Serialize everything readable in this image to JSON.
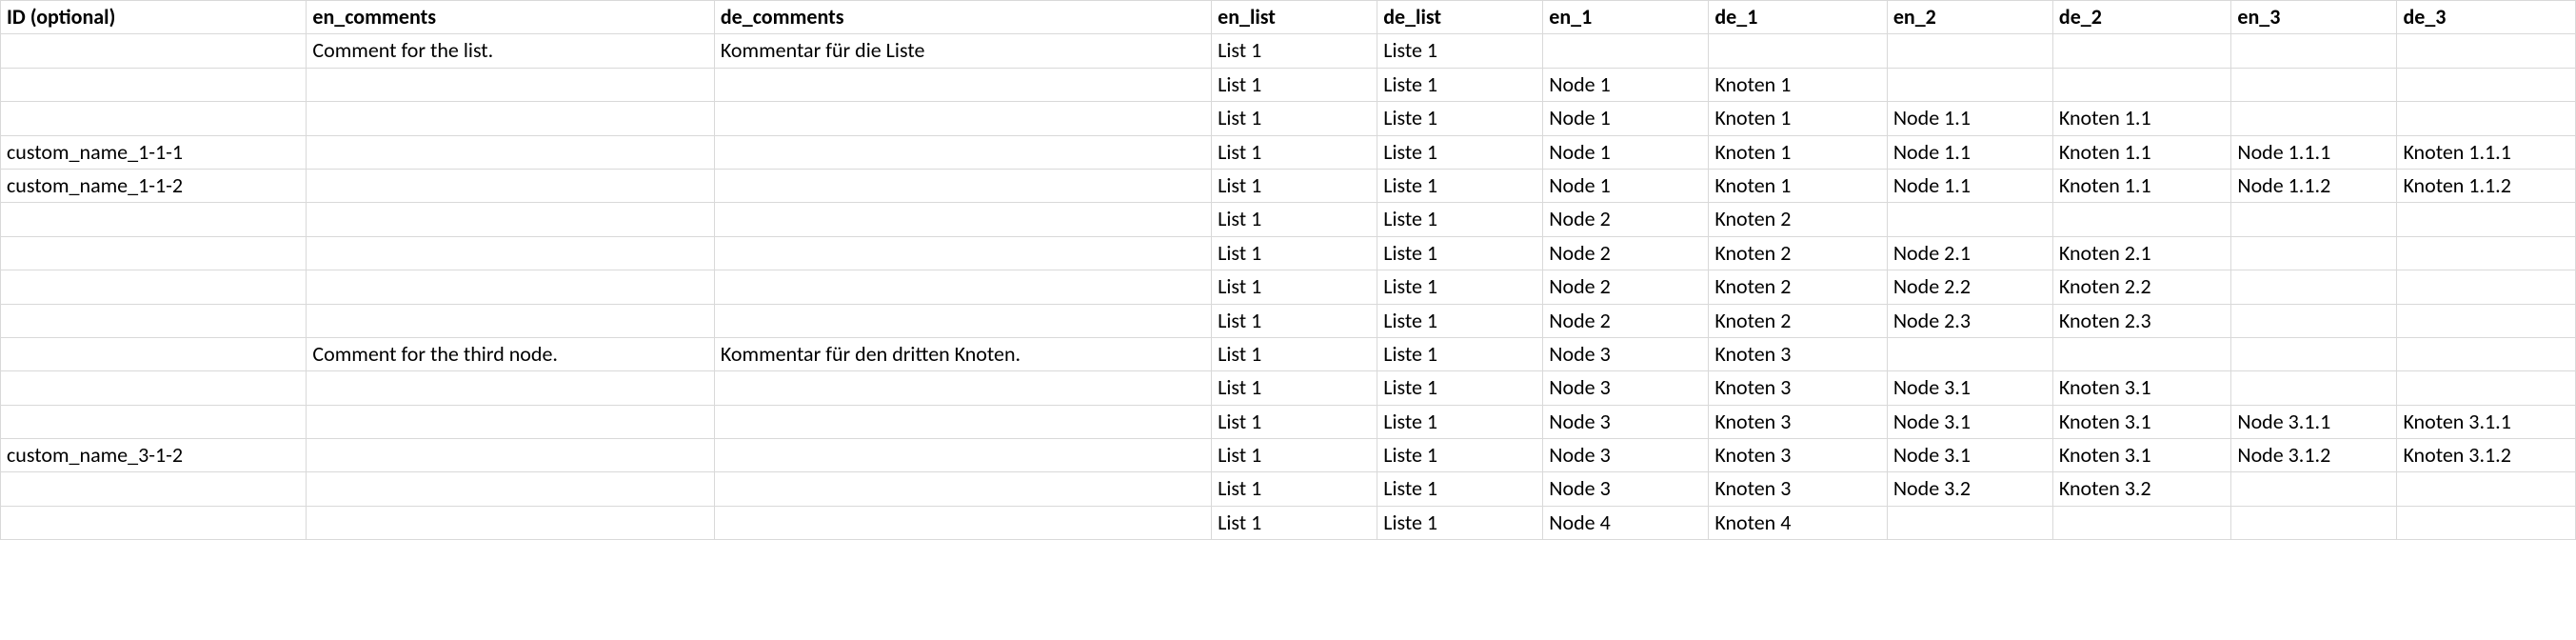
{
  "table": {
    "headers": [
      "ID (optional)",
      "en_comments",
      "de_comments",
      "en_list",
      "de_list",
      "en_1",
      "de_1",
      "en_2",
      "de_2",
      "en_3",
      "de_3"
    ],
    "rows": [
      [
        "",
        "Comment for the list.",
        "Kommentar für die Liste",
        "List 1",
        "Liste 1",
        "",
        "",
        "",
        "",
        "",
        ""
      ],
      [
        "",
        "",
        "",
        "List 1",
        "Liste 1",
        "Node 1",
        "Knoten 1",
        "",
        "",
        "",
        ""
      ],
      [
        "",
        "",
        "",
        "List 1",
        "Liste 1",
        "Node 1",
        "Knoten 1",
        "Node 1.1",
        "Knoten 1.1",
        "",
        ""
      ],
      [
        "custom_name_1-1-1",
        "",
        "",
        "List 1",
        "Liste 1",
        "Node 1",
        "Knoten 1",
        "Node 1.1",
        "Knoten 1.1",
        "Node 1.1.1",
        "Knoten 1.1.1"
      ],
      [
        "custom_name_1-1-2",
        "",
        "",
        "List 1",
        "Liste 1",
        "Node 1",
        "Knoten 1",
        "Node 1.1",
        "Knoten 1.1",
        "Node 1.1.2",
        "Knoten 1.1.2"
      ],
      [
        "",
        "",
        "",
        "List 1",
        "Liste 1",
        "Node 2",
        "Knoten 2",
        "",
        "",
        "",
        ""
      ],
      [
        "",
        "",
        "",
        "List 1",
        "Liste 1",
        "Node 2",
        "Knoten 2",
        "Node 2.1",
        "Knoten 2.1",
        "",
        ""
      ],
      [
        "",
        "",
        "",
        "List 1",
        "Liste 1",
        "Node 2",
        "Knoten 2",
        "Node 2.2",
        "Knoten 2.2",
        "",
        ""
      ],
      [
        "",
        "",
        "",
        "List 1",
        "Liste 1",
        "Node 2",
        "Knoten 2",
        "Node 2.3",
        "Knoten 2.3",
        "",
        ""
      ],
      [
        "",
        "Comment for the third node.",
        "Kommentar für den dritten Knoten.",
        "List 1",
        "Liste 1",
        "Node 3",
        "Knoten 3",
        "",
        "",
        "",
        ""
      ],
      [
        "",
        "",
        "",
        "List 1",
        "Liste 1",
        "Node 3",
        "Knoten 3",
        "Node 3.1",
        "Knoten 3.1",
        "",
        ""
      ],
      [
        "",
        "",
        "",
        "List 1",
        "Liste 1",
        "Node 3",
        "Knoten 3",
        "Node 3.1",
        "Knoten 3.1",
        "Node 3.1.1",
        "Knoten 3.1.1"
      ],
      [
        "custom_name_3-1-2",
        "",
        "",
        "List 1",
        "Liste 1",
        "Node 3",
        "Knoten 3",
        "Node 3.1",
        "Knoten 3.1",
        "Node 3.1.2",
        "Knoten 3.1.2"
      ],
      [
        "",
        "",
        "",
        "List 1",
        "Liste 1",
        "Node 3",
        "Knoten 3",
        "Node 3.2",
        "Knoten 3.2",
        "",
        ""
      ],
      [
        "",
        "",
        "",
        "List 1",
        "Liste 1",
        "Node 4",
        "Knoten 4",
        "",
        "",
        "",
        ""
      ]
    ]
  }
}
